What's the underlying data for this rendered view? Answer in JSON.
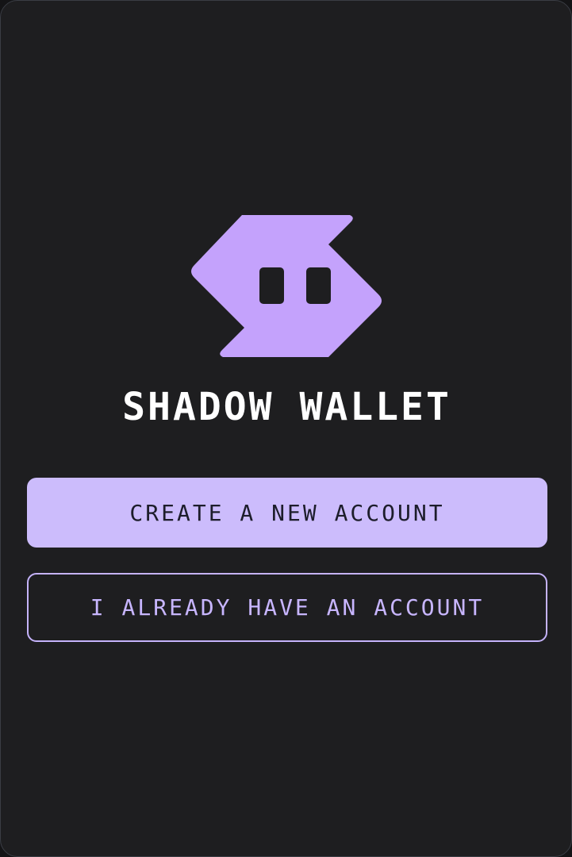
{
  "app": {
    "title": "SHADOW WALLET",
    "logo_icon": "ghost-arrow-logo"
  },
  "actions": {
    "create_label": "CREATE A NEW ACCOUNT",
    "restore_label": "I ALREADY HAVE AN ACCOUNT"
  },
  "colors": {
    "background": "#1e1e20",
    "accent": "#c4a2fc",
    "primary_button": "#ccbcfc",
    "secondary_border": "#c5b3fb",
    "title_text": "#ffffff"
  }
}
